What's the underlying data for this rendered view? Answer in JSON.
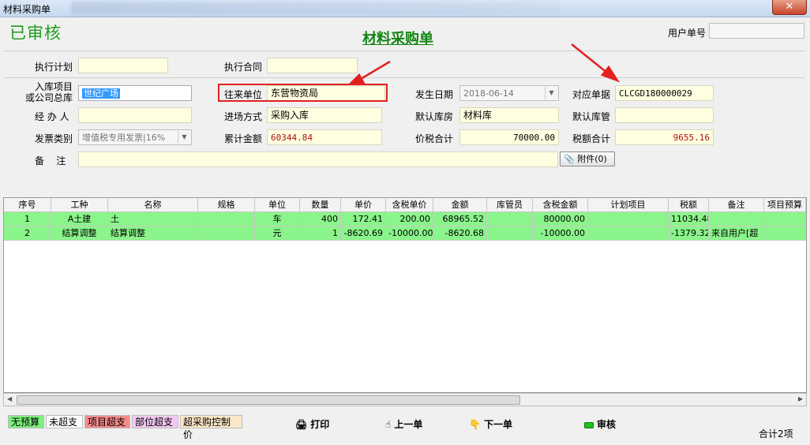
{
  "window": {
    "title": "材料采购单",
    "close_label": "✕"
  },
  "status_label": "已审核",
  "form_title": "材料采购单",
  "user_doc_no": {
    "label": "用户单号",
    "value": ""
  },
  "fields": {
    "exec_plan": {
      "label": "执行计划",
      "value": ""
    },
    "exec_contract": {
      "label": "执行合同",
      "value": ""
    },
    "project_line1": "入库项目",
    "project_line2": "或公司总库",
    "project_value": "世纪广场",
    "partner": {
      "label": "往来单位",
      "value": "东营物资局"
    },
    "occur_date": {
      "label": "发生日期",
      "value": "2018-06-14"
    },
    "corresp_doc": {
      "label": "对应单据",
      "value": "CLCGD180000029"
    },
    "handler": {
      "label": "经 办 人",
      "value": ""
    },
    "entry_mode": {
      "label": "进场方式",
      "value": "采购入库"
    },
    "default_warehouse": {
      "label": "默认库房",
      "value": "材料库"
    },
    "default_keeper": {
      "label": "默认库管",
      "value": ""
    },
    "invoice_type": {
      "label": "发票类别",
      "value": "增值税专用发票|16%"
    },
    "accum_amount": {
      "label": "累计金额",
      "value": "60344.84"
    },
    "price_tax_total": {
      "label": "价税合计",
      "value": "70000.00"
    },
    "tax_total": {
      "label": "税额合计",
      "value": "9655.16"
    },
    "remark": {
      "label": "备    注",
      "value": ""
    },
    "attach_label": "附件(0)"
  },
  "grid": {
    "headers": [
      "序号",
      "工种",
      "名称",
      "规格",
      "单位",
      "数量",
      "单价",
      "含税单价",
      "金额",
      "库管员",
      "含税金额",
      "计划项目",
      "税额",
      "备注",
      "项目预算"
    ],
    "rows": [
      [
        "1",
        "A土建",
        "土",
        "",
        "车",
        "400",
        "172.41",
        "200.00",
        "68965.52",
        "",
        "80000.00",
        "",
        "11034.48",
        "",
        ""
      ],
      [
        "2",
        "结算调整",
        "结算调整",
        "",
        "元",
        "1",
        "-8620.69",
        "-10000.00",
        "-8620.68",
        "",
        "-10000.00",
        "",
        "-1379.32",
        "来自用户[超",
        ""
      ]
    ]
  },
  "legend": [
    {
      "label": "无预算",
      "bg": "#7df07d"
    },
    {
      "label": "未超支",
      "bg": "#ffffff"
    },
    {
      "label": "项目超支",
      "bg": "#f58a8a"
    },
    {
      "label": "部位超支",
      "bg": "#f3c8f3"
    },
    {
      "label": "超采购控制价",
      "bg": "#fbe7c8"
    }
  ],
  "toolbar": {
    "print": "打印",
    "prev": "上一单",
    "next": "下一单",
    "audit": "审核"
  },
  "total_label": "合计2项"
}
